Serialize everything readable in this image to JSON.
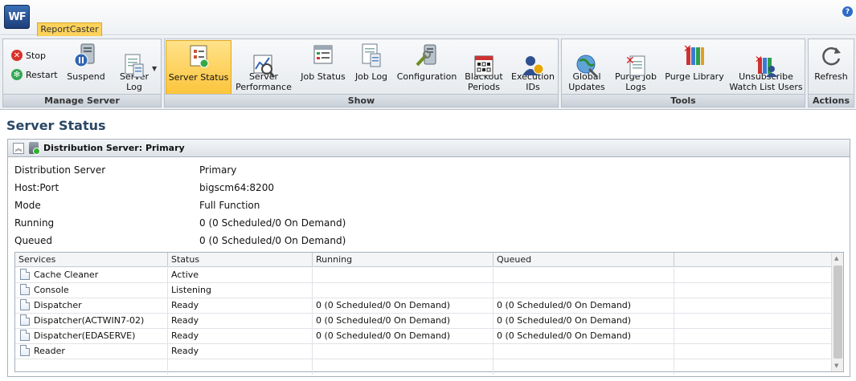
{
  "app": {
    "logo_text": "WF",
    "help_icon": "?",
    "tab": "ReportCaster"
  },
  "ribbon": {
    "manage": {
      "title": "Manage Server",
      "stop": "Stop",
      "restart": "Restart",
      "suspend": "Suspend",
      "server_log": "Server\nLog"
    },
    "show": {
      "title": "Show",
      "server_status": "Server Status",
      "server_performance": "Server\nPerformance",
      "job_status": "Job Status",
      "job_log": "Job Log",
      "configuration": "Configuration",
      "blackout_periods": "Blackout\nPeriods",
      "execution_ids": "Execution\nIDs"
    },
    "tools": {
      "title": "Tools",
      "global_updates": "Global\nUpdates",
      "purge_job_logs": "Purge Job\nLogs",
      "purge_library": "Purge Library",
      "unsubscribe": "Unsubscribe\nWatch List Users"
    },
    "actions": {
      "title": "Actions",
      "refresh": "Refresh"
    }
  },
  "page": {
    "title": "Server Status"
  },
  "panel": {
    "header": "Distribution Server: Primary",
    "props": [
      {
        "k": "Distribution Server",
        "v": "Primary"
      },
      {
        "k": "Host:Port",
        "v": "bigscm64:8200"
      },
      {
        "k": "Mode",
        "v": "Full Function"
      },
      {
        "k": "Running",
        "v": "0 (0 Scheduled/0 On Demand)"
      },
      {
        "k": "Queued",
        "v": "0 (0 Scheduled/0 On Demand)"
      }
    ]
  },
  "grid": {
    "columns": [
      "Services",
      "Status",
      "Running",
      "Queued"
    ],
    "rows": [
      {
        "service": "Cache Cleaner",
        "status": "Active",
        "running": "",
        "queued": ""
      },
      {
        "service": "Console",
        "status": "Listening",
        "running": "",
        "queued": ""
      },
      {
        "service": "Dispatcher",
        "status": "Ready",
        "running": "0 (0 Scheduled/0 On Demand)",
        "queued": "0 (0 Scheduled/0 On Demand)"
      },
      {
        "service": "Dispatcher(ACTWIN7-02)",
        "status": "Ready",
        "running": "0 (0 Scheduled/0 On Demand)",
        "queued": "0 (0 Scheduled/0 On Demand)"
      },
      {
        "service": "Dispatcher(EDASERVE)",
        "status": "Ready",
        "running": "0 (0 Scheduled/0 On Demand)",
        "queued": "0 (0 Scheduled/0 On Demand)"
      },
      {
        "service": "Reader",
        "status": "Ready",
        "running": "",
        "queued": ""
      }
    ]
  }
}
